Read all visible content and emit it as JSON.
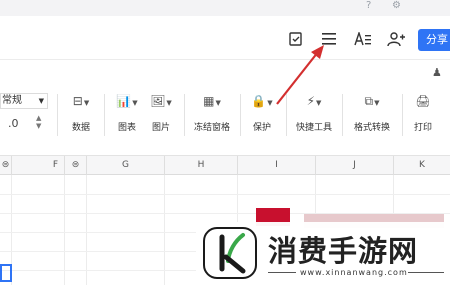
{
  "header": {
    "share_label": "分享",
    "icons": [
      "doc-check-icon",
      "menu-icon",
      "text-format-icon",
      "add-user-icon"
    ]
  },
  "ribbon": {
    "number_format": "常规",
    "decimal_value": ".0",
    "tools": [
      {
        "label": "数据",
        "icon": "data-icon"
      },
      {
        "label": "图表",
        "icon": "chart-icon"
      },
      {
        "label": "图片",
        "icon": "image-icon"
      },
      {
        "label": "冻结窗格",
        "icon": "freeze-panes-icon"
      },
      {
        "label": "保护",
        "icon": "lock-icon"
      },
      {
        "label": "快捷工具",
        "icon": "quick-tools-icon"
      },
      {
        "label": "格式转换",
        "icon": "format-convert-icon"
      },
      {
        "label": "打印",
        "icon": "print-icon"
      }
    ]
  },
  "grid": {
    "columns": [
      "F",
      "G",
      "H",
      "I",
      "J",
      "K"
    ]
  },
  "watermark": {
    "brand": "消费手游网",
    "url": "www.xinnanwang.com"
  },
  "colors": {
    "accent": "#2f74f5",
    "annotation_arrow": "#d32f2f"
  }
}
